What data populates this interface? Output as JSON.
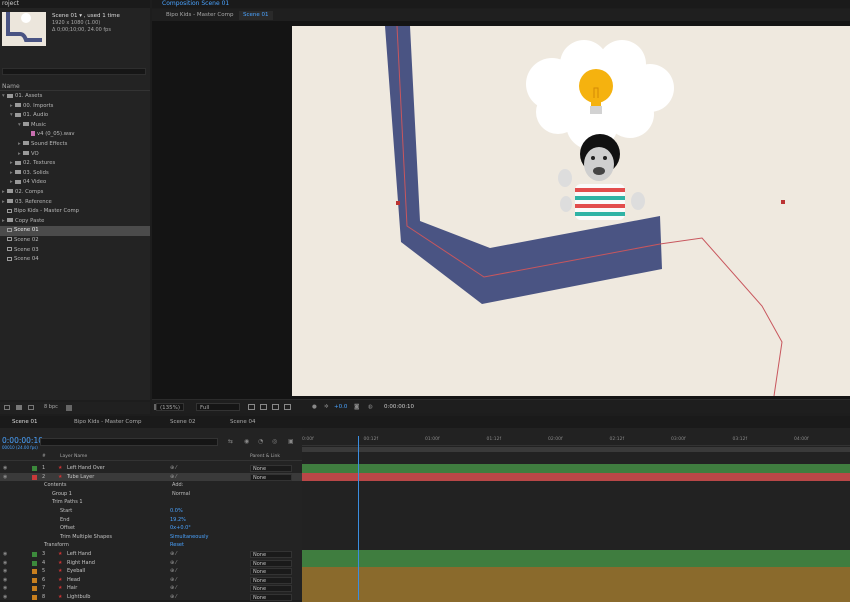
{
  "project": {
    "header": "roject",
    "comp_name": "Scene 01 ▾ , used 1 time",
    "comp_res": "1920 x 1080 (1.00)",
    "comp_dur": "Δ 0;00;10;00, 24.00 fps",
    "col_name": "Name",
    "items": [
      {
        "label": "01. Assets",
        "kind": "folder",
        "indent": 0,
        "open": true
      },
      {
        "label": "00. Imports",
        "kind": "folder",
        "indent": 1,
        "open": false
      },
      {
        "label": "01. Audio",
        "kind": "folder",
        "indent": 1,
        "open": true
      },
      {
        "label": "Music",
        "kind": "folder",
        "indent": 2,
        "open": true
      },
      {
        "label": "v4 (0_05).wav",
        "kind": "audio",
        "indent": 3,
        "open": false
      },
      {
        "label": "Sound Effects",
        "kind": "folder",
        "indent": 2,
        "open": false
      },
      {
        "label": "VO",
        "kind": "folder",
        "indent": 2,
        "open": false
      },
      {
        "label": "02. Textures",
        "kind": "folder",
        "indent": 1,
        "open": false
      },
      {
        "label": "03. Solids",
        "kind": "folder",
        "indent": 1,
        "open": false
      },
      {
        "label": "04 Video",
        "kind": "folder",
        "indent": 1,
        "open": false
      },
      {
        "label": "02. Comps",
        "kind": "folder",
        "indent": 0,
        "open": false
      },
      {
        "label": "03. Reference",
        "kind": "folder",
        "indent": 0,
        "open": false
      },
      {
        "label": "Bipo Kids - Master Comp",
        "kind": "comp",
        "indent": 0,
        "open": false
      },
      {
        "label": "Copy Paste",
        "kind": "folder",
        "indent": 0,
        "open": false
      },
      {
        "label": "Scene 01",
        "kind": "comp",
        "indent": 0,
        "open": false,
        "selected": true
      },
      {
        "label": "Scene 02",
        "kind": "comp",
        "indent": 0,
        "open": false
      },
      {
        "label": "Scene 03",
        "kind": "comp",
        "indent": 0,
        "open": false
      },
      {
        "label": "Scene 04",
        "kind": "comp",
        "indent": 0,
        "open": false
      }
    ],
    "footer_bpc": "8 bpc"
  },
  "composition": {
    "header": "Composition Scene 01",
    "tabs": [
      "Bipo Kids - Master Comp",
      "Scene 01"
    ],
    "zoom": "(135%)",
    "resolution": "Full",
    "exposure": "+0.0",
    "timecode": "0:00:00:10"
  },
  "timeline": {
    "tabs": [
      "Scene 01",
      "Bipo Kids - Master Comp",
      "Scene 02",
      "Scene 04"
    ],
    "timecode": "0:00:00:10",
    "timecode_sub": "00010 (24.00 fps)",
    "col_layer_name": "Layer Name",
    "col_parent": "Parent & Link",
    "layers": [
      {
        "num": "1",
        "name": "Left Hand Over",
        "color": "#3c8a3c",
        "parent": "None",
        "bar": "#3f7d3f",
        "kind": "layer"
      },
      {
        "num": "2",
        "name": "Tube Layer",
        "color": "#c83a3a",
        "parent": "None",
        "bar": "#b94747",
        "kind": "layer",
        "selected": true
      }
    ],
    "props": [
      {
        "label": "Contents",
        "indent": 1,
        "extra": "Add:"
      },
      {
        "label": "Group 1",
        "indent": 2,
        "extra": "Normal"
      },
      {
        "label": "Trim Paths 1",
        "indent": 2,
        "extra": ""
      },
      {
        "label": "Start",
        "indent": 3,
        "value": "0.0%"
      },
      {
        "label": "End",
        "indent": 3,
        "value": "19.2%"
      },
      {
        "label": "Offset",
        "indent": 3,
        "value": "0x+0.0°"
      },
      {
        "label": "Trim Multiple Shapes",
        "indent": 3,
        "value": "Simultaneously"
      },
      {
        "label": "Transform",
        "indent": 1,
        "value": "Reset"
      }
    ],
    "layers2": [
      {
        "num": "3",
        "name": "Left Hand",
        "color": "#3c8a3c",
        "parent": "None",
        "bar": "#3f7d3f"
      },
      {
        "num": "4",
        "name": "Right Hand",
        "color": "#3c8a3c",
        "parent": "None",
        "bar": "#3f7d3f"
      },
      {
        "num": "5",
        "name": "Eyeball",
        "color": "#c87f1e",
        "parent": "None",
        "bar": "#8a6a2c"
      },
      {
        "num": "6",
        "name": "Head",
        "color": "#c87f1e",
        "parent": "None",
        "bar": "#8a6a2c"
      },
      {
        "num": "7",
        "name": "Hair",
        "color": "#c87f1e",
        "parent": "None",
        "bar": "#8a6a2c"
      },
      {
        "num": "8",
        "name": "Lightbulb",
        "color": "#c87f1e",
        "parent": "None",
        "bar": "#8a6a2c"
      }
    ],
    "ruler": [
      "0:00f",
      "00:12f",
      "01:00f",
      "01:12f",
      "02:00f",
      "02:12f",
      "03:00f",
      "03:12f",
      "04:00f"
    ]
  },
  "colors": {
    "accent": "#4aa3ff",
    "tube": "#4a5483",
    "canvas_bg": "#efe9df"
  }
}
